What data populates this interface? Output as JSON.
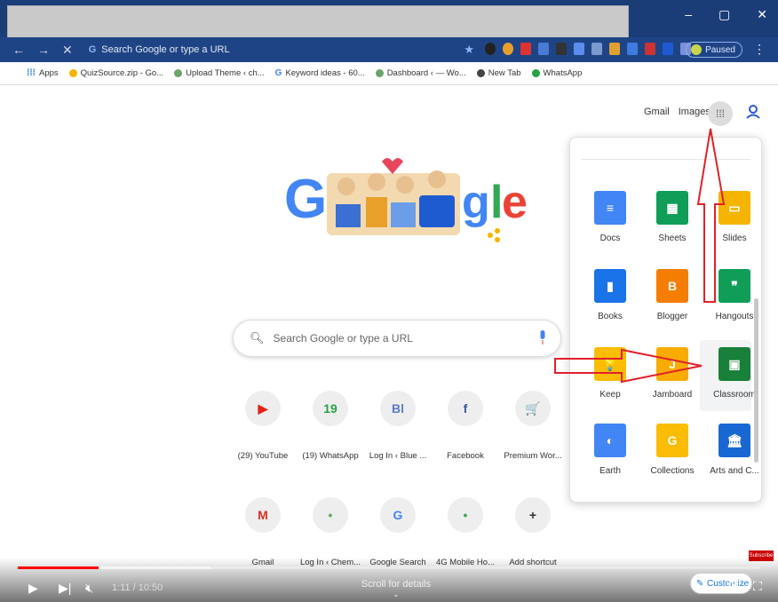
{
  "browser": {
    "omnibox_placeholder": "Search Google or type a URL",
    "paused_label": "Paused",
    "bookmarks": [
      "Apps",
      "QuizSource.zip - Go...",
      "Upload Theme ‹ ch...",
      "Keyword ideas - 60...",
      "Dashboard ‹ — Wo...",
      "New Tab",
      "WhatsApp"
    ]
  },
  "page": {
    "gmail_link": "Gmail",
    "images_link": "Images",
    "search_placeholder": "Search Google or type a URL",
    "shortcuts": [
      {
        "label": "(29) YouTube",
        "glyph": "▶",
        "color": "#e62117"
      },
      {
        "label": "(19) WhatsApp",
        "glyph": "19",
        "color": "#25a244"
      },
      {
        "label": "Log In ‹ Blue ...",
        "glyph": "Bl",
        "color": "#5a7bd0"
      },
      {
        "label": "Facebook",
        "glyph": "f",
        "color": "#3b5998"
      },
      {
        "label": "Premium Wor...",
        "glyph": "🛒",
        "color": "#5aa0c8"
      },
      {
        "label": "Gmail",
        "glyph": "M",
        "color": "#d93025"
      },
      {
        "label": "Log In ‹ Chem...",
        "glyph": "•",
        "color": "#6aa66a"
      },
      {
        "label": "Google Search",
        "glyph": "G",
        "color": "#4285f4"
      },
      {
        "label": "4G Mobile Ho...",
        "glyph": "•",
        "color": "#4aa35a"
      },
      {
        "label": "Add shortcut",
        "glyph": "+",
        "color": "#333"
      }
    ]
  },
  "launcher": {
    "apps": [
      {
        "label": "Docs",
        "color": "#4285f4",
        "glyph": "≡"
      },
      {
        "label": "Sheets",
        "color": "#0f9d58",
        "glyph": "▦"
      },
      {
        "label": "Slides",
        "color": "#f4b400",
        "glyph": "▭"
      },
      {
        "label": "Books",
        "color": "#1a73e8",
        "glyph": "▮"
      },
      {
        "label": "Blogger",
        "color": "#f57d00",
        "glyph": "B"
      },
      {
        "label": "Hangouts",
        "color": "#0f9d58",
        "glyph": "❞"
      },
      {
        "label": "Keep",
        "color": "#fbbc04",
        "glyph": "💡"
      },
      {
        "label": "Jamboard",
        "color": "#f9ab00",
        "glyph": "J"
      },
      {
        "label": "Classroom",
        "color": "#188038",
        "glyph": "▣"
      },
      {
        "label": "Earth",
        "color": "#4285f4",
        "glyph": "◐"
      },
      {
        "label": "Collections",
        "color": "#fbbc04",
        "glyph": "G"
      },
      {
        "label": "Arts and C...",
        "color": "#1967d2",
        "glyph": "🏛"
      }
    ]
  },
  "player": {
    "time": "1:11 / 10:50",
    "scroll_hint": "Scroll for details",
    "subscribe": "Subscribe",
    "customize": "Customize",
    "progress_fraction": 0.109,
    "buffered_fraction": 0.26
  }
}
